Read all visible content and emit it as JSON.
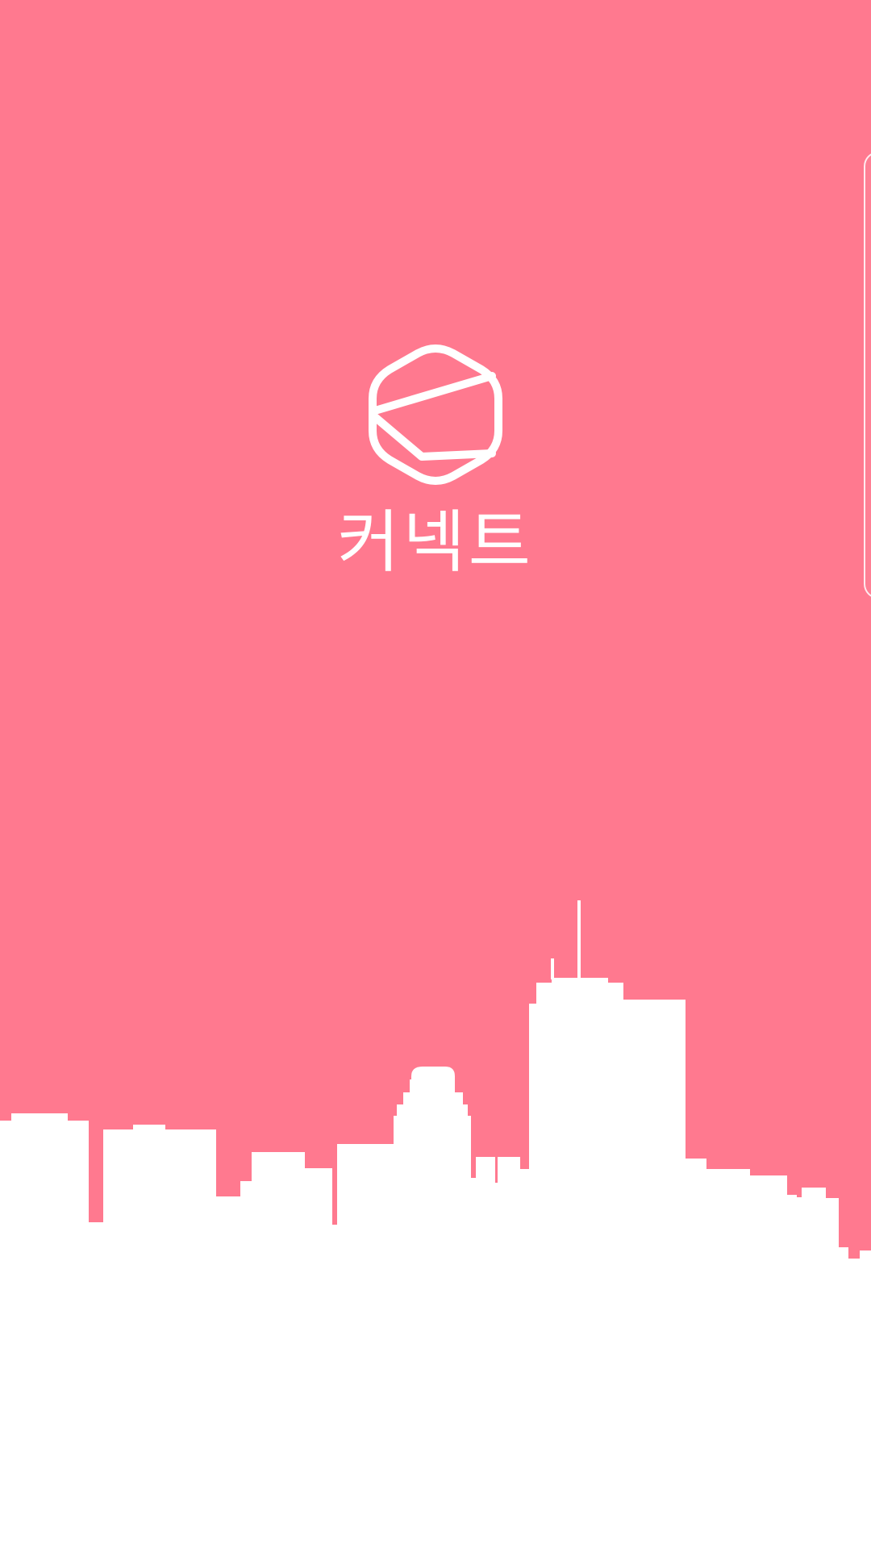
{
  "app": {
    "name": "커넥트",
    "logo_icon": "hexagon-envelope-icon",
    "background_color": "#ff798f",
    "foreground_color": "#ffffff"
  },
  "decor": {
    "skyline_icon": "city-skyline-illustration",
    "side_card_icon": "card-edge"
  }
}
